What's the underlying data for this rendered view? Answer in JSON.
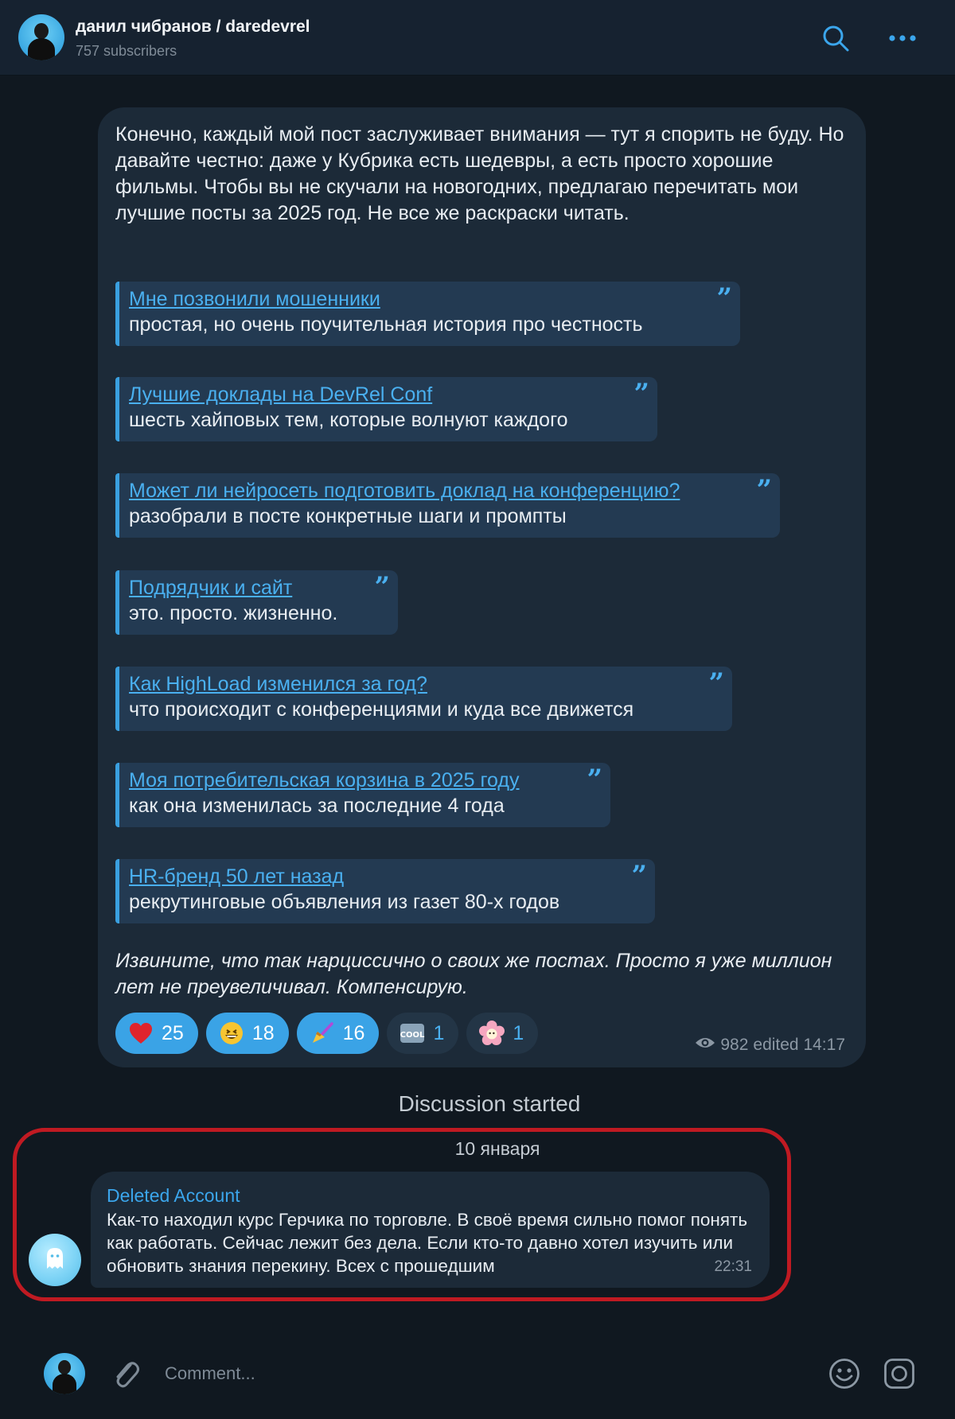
{
  "header": {
    "title": "данил чибранов / daredevrel",
    "subtitle": "757 subscribers",
    "icons": [
      "search-icon",
      "more-icon"
    ]
  },
  "post": {
    "text": "Конечно, каждый мой пост заслуживает внимания — тут я спорить не буду. Но давайте честно: даже у Кубрика есть шедевры, а есть просто хорошие фильмы. Чтобы вы не скучали на новогодних, предлагаю перечитать мои лучшие посты за 2025 год. Не все же раскраски читать.",
    "quotes": [
      {
        "title": "Мне позвонили мошенники",
        "desc": "простая, но очень поучительная история про честность"
      },
      {
        "title": "Лучшие доклады на DevRel Conf",
        "desc": "шесть хайповых тем, которые волнуют каждого"
      },
      {
        "title": "Может ли нейросеть подготовить доклад на конференцию?",
        "desc": "разобрали в посте конкретные шаги и промпты"
      },
      {
        "title": "Подрядчик и сайт",
        "desc": "это. просто. жизненно."
      },
      {
        "title": "Как HighLoad изменился за год?",
        "desc": "что происходит с конференциями и куда все движется"
      },
      {
        "title": "Моя потребительская корзина в 2025 году",
        "desc": "как она изменилась за последние 4 года"
      },
      {
        "title": "HR-бренд 50 лет назад",
        "desc": "рекрутинговые объявления из газет 80-х годов"
      }
    ],
    "italic": "Извините, что так нарциссично о своих же постах. Просто я уже миллион лет не преувеличивал. Компенсирую.",
    "reactions": [
      {
        "emoji": "heart-icon",
        "count": "25",
        "active": true
      },
      {
        "emoji": "grinning-face-icon",
        "count": "18",
        "active": true
      },
      {
        "emoji": "broom-icon",
        "count": "16",
        "active": true
      },
      {
        "emoji": "cool-icon",
        "count": "1",
        "active": false
      },
      {
        "emoji": "flower-icon",
        "count": "1",
        "active": false
      }
    ],
    "views": "982",
    "edited": "edited 14:17"
  },
  "discussion_label": "Discussion started",
  "date_label": "10 января",
  "comment": {
    "author": "Deleted Account",
    "text": "Как-то находил курс Герчика по торговле. В своё время сильно помог понять как работать. Сейчас лежит без дела. Если кто-то давно хотел изучить или обновить знания перекину. Всех с прошедшим",
    "time": "22:31"
  },
  "input": {
    "placeholder": "Comment..."
  },
  "colors": {
    "accent": "#3aa3e6",
    "link": "#4ab0f0",
    "background": "#101820",
    "bubble": "#1c2a38",
    "highlight": "#c01a22"
  }
}
